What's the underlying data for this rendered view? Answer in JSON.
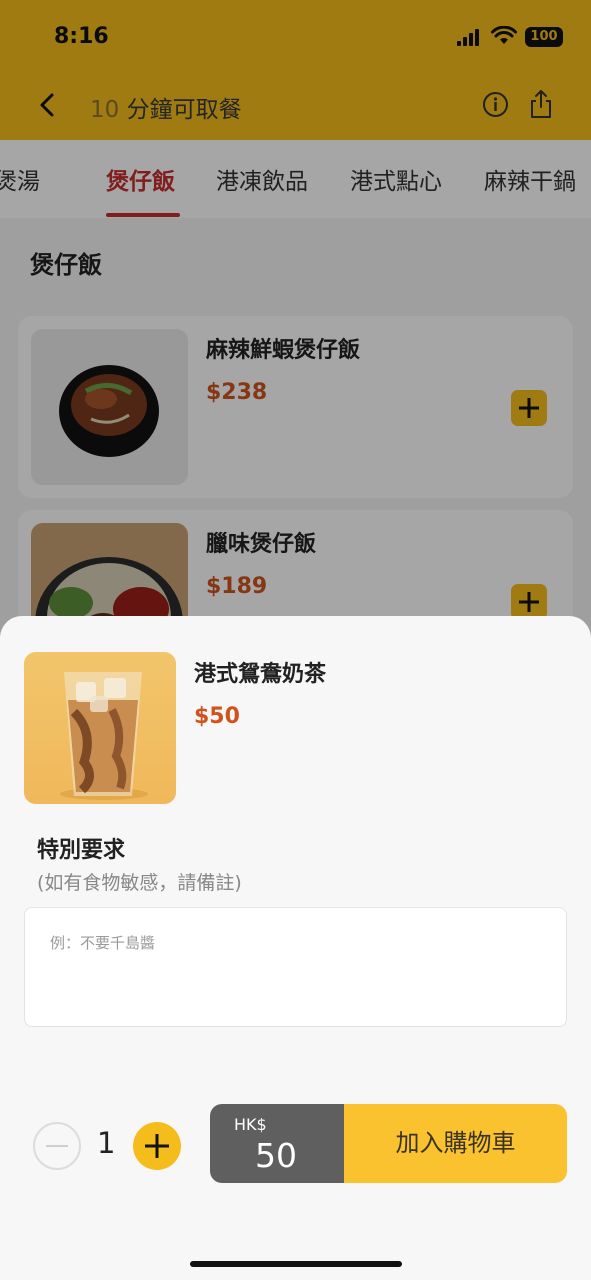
{
  "status_bar": {
    "time": "8:16",
    "battery": "100"
  },
  "header": {
    "pickup_num": "10",
    "pickup_text": " 分鐘可取餐"
  },
  "tabs": [
    {
      "label": "煲湯"
    },
    {
      "label": "煲仔飯"
    },
    {
      "label": "港凍飲品"
    },
    {
      "label": "港式點心"
    },
    {
      "label": "麻辣干鍋"
    }
  ],
  "section": {
    "title": "煲仔飯"
  },
  "menu_items": [
    {
      "name": "麻辣鮮蝦煲仔飯",
      "price": "$238"
    },
    {
      "name": "臘味煲仔飯",
      "price": "$189"
    }
  ],
  "sheet": {
    "product_name": "港式鴛鴦奶茶",
    "product_price": "$50",
    "request_title": "特別要求",
    "request_hint": "(如有食物敏感，請備註)",
    "notes_placeholder": "例：不要千島醬",
    "quantity": "1",
    "currency": "HK$",
    "total": "50",
    "add_to_cart": "加入購物車"
  }
}
